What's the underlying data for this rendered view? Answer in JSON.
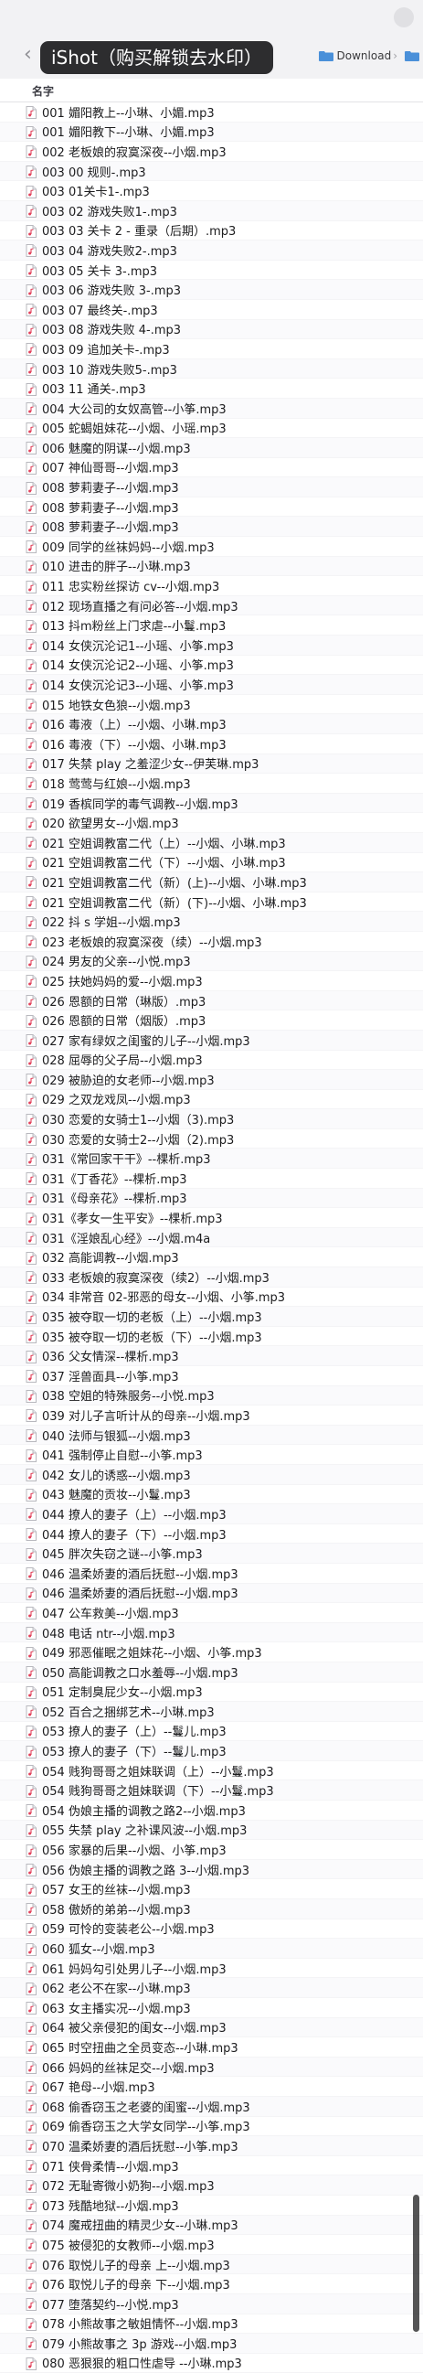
{
  "toolbar": {
    "watermark": "iShot（购买解锁去水印）",
    "breadcrumb": [
      "Download",
      ""
    ]
  },
  "columns": {
    "name": "名字"
  },
  "files": [
    "001 媚阳教上--小琳、小媚.mp3",
    "001 媚阳教下--小琳、小媚.mp3",
    "002 老板娘的寂寞深夜--小烟.mp3",
    "003 00 规则-.mp3",
    "003 01关卡1-.mp3",
    "003 02 游戏失败1-.mp3",
    "003 03 关卡 2 - 重录（后期）.mp3",
    "003 04 游戏失败2-.mp3",
    "003 05 关卡 3-.mp3",
    "003 06 游戏失败 3-.mp3",
    "003 07 最终关-.mp3",
    "003 08 游戏失败 4-.mp3",
    "003 09 追加关卡-.mp3",
    "003 10 游戏失败5-.mp3",
    "003 11 通关-.mp3",
    "004 大公司的女奴高管--小筝.mp3",
    "005 蛇蝎姐妹花--小烟、小瑶.mp3",
    "006 魅魔的阴谋--小烟.mp3",
    "007 神仙哥哥--小烟.mp3",
    "008 萝莉妻子--小烟.mp3",
    "008 萝莉妻子--小烟.mp3",
    "008 萝莉妻子--小烟.mp3",
    "009 同学的丝袜妈妈--小烟.mp3",
    "010 进击的胖子--小琳.mp3",
    "011 忠实粉丝探访 cv--小烟.mp3",
    "012 现场直播之有问必答--小烟.mp3",
    "013 抖m粉丝上门求虐--小鬘.mp3",
    "014 女侠沉沦记1--小瑶、小筝.mp3",
    "014 女侠沉沦记2--小瑶、小筝.mp3",
    "014 女侠沉沦记3--小瑶、小筝.mp3",
    "015 地铁女色狼--小烟.mp3",
    "016 毒液（上）--小烟、小琳.mp3",
    "016 毒液（下）--小烟、小琳.mp3",
    "017 失禁 play 之羞涩少女--伊芙琳.mp3",
    "018 莺莺与红娘--小烟.mp3",
    "019 香槟同学的毒气调教--小烟.mp3",
    "020 欲望男女--小烟.mp3",
    "021 空姐调教富二代（上）--小烟、小琳.mp3",
    "021 空姐调教富二代（下）--小烟、小琳.mp3",
    "021 空姐调教富二代（新）(上)--小烟、小琳.mp3",
    "021 空姐调教富二代（新）(下)--小烟、小琳.mp3",
    "022 抖 s 学姐--小烟.mp3",
    "023 老板娘的寂寞深夜（续）--小烟.mp3",
    "024 男友的父亲--小悦.mp3",
    "025 扶她妈妈的爱--小烟.mp3",
    "026 恩额的日常（琳版）.mp3",
    "026 恩额的日常（烟版）.mp3",
    "027 家有绿奴之闺蜜的儿子--小烟.mp3",
    "028 屈辱的父子局--小烟.mp3",
    "029 被胁迫的女老师--小烟.mp3",
    "029 之双龙戏凤--小烟.mp3",
    "030 恋爱的女骑士1--小烟（3).mp3",
    "030 恋爱的女骑士2--小烟（2).mp3",
    "031《常回家干干》--棵析.mp3",
    "031《丁香花》--棵析.mp3",
    "031《母亲花》--棵析.mp3",
    "031《孝女一生平安》--棵析.mp3",
    "031《淫娘乱心经》--小烟.m4a",
    "032 高能调教--小烟.mp3",
    "033 老板娘的寂寞深夜（续2）--小烟.mp3",
    "034 非常音 02-邪恶的母女--小烟、小筝.mp3",
    "035 被夺取一切的老板（上）--小烟.mp3",
    "035 被夺取一切的老板（下）--小烟.mp3",
    "036 父女情深--棵析.mp3",
    "037 淫兽面具--小筝.mp3",
    "038 空姐的特殊服务--小悦.mp3",
    "039 对儿子言听计从的母亲--小烟.mp3",
    "040 法师与银狐--小烟.mp3",
    "041 强制停止自慰--小筝.mp3",
    "042 女儿的诱惑--小烟.mp3",
    "043 魅魔的贡妆--小鬘.mp3",
    "044 撩人的妻子（上）--小烟.mp3",
    "044 撩人的妻子（下）--小烟.mp3",
    "045 胖次失窃之谜--小筝.mp3",
    "046 温柔娇妻的酒后抚慰--小烟.mp3",
    "046 温柔娇妻的酒后抚慰--小烟.mp3",
    "047 公车救美--小烟.mp3",
    "048 电话 ntr--小烟.mp3",
    "049 邪恶催眠之姐妹花--小烟、小筝.mp3",
    "050 高能调教之口水羞辱--小烟.mp3",
    "051 定制臭屁少女--小烟.mp3",
    "052 百合之捆绑艺术--小琳.mp3",
    "053 撩人的妻子（上）--鬘儿.mp3",
    "053 撩人的妻子（下）--鬘儿.mp3",
    "054 贱狗哥哥之姐妹联调（上）--小鬘.mp3",
    "054 贱狗哥哥之姐妹联调（下）--小鬘.mp3",
    "054 伪娘主播的调教之路2--小烟.mp3",
    "055 失禁 play 之补课风波--小烟.mp3",
    "056 家暴的后果--小烟、小筝.mp3",
    "056 伪娘主播的调教之路 3--小烟.mp3",
    "057 女王的丝袜--小烟.mp3",
    "058 傲娇的弟弟--小烟.mp3",
    "059 可怜的变装老公--小烟.mp3",
    "060 狐女--小烟.mp3",
    "061 妈妈勾引处男儿子--小烟.mp3",
    "062 老公不在家--小琳.mp3",
    "063 女主播实况--小烟.mp3",
    "064 被父亲侵犯的闺女--小烟.mp3",
    "065 时空扭曲之全员变态--小琳.mp3",
    "066 妈妈的丝袜足交--小烟.mp3",
    "067 艳母--小烟.mp3",
    "068 偷香窃玉之老婆的闺蜜--小烟.mp3",
    "069 偷香窃玉之大学女同学--小筝.mp3",
    "070 温柔娇妻的酒后抚慰--小筝.mp3",
    "071 侠骨柔情--小烟.mp3",
    "072 无耻寄微小奶狗--小烟.mp3",
    "073 残酷地狱--小烟.mp3",
    "074 魔戒扭曲的精灵少女--小琳.mp3",
    "075 被侵犯的女教师--小烟.mp3",
    "076 取悦儿子的母亲 上--小烟.mp3",
    "076 取悦儿子的母亲 下--小烟.mp3",
    "077 堕落契约--小悦.mp3",
    "078 小熊故事之敏姐情怀--小烟.mp3",
    "079 小熊故事之 3p 游戏--小烟.mp3",
    "080 恶狠狠的粗口性虐导 --小琳.mp3"
  ],
  "icons": {
    "file": "audio-file-icon",
    "folder": "folder-icon",
    "back": "chevron-left-icon"
  },
  "colors": {
    "watermark_bg": "#2d2d2f",
    "folder": "#4a90d9"
  }
}
